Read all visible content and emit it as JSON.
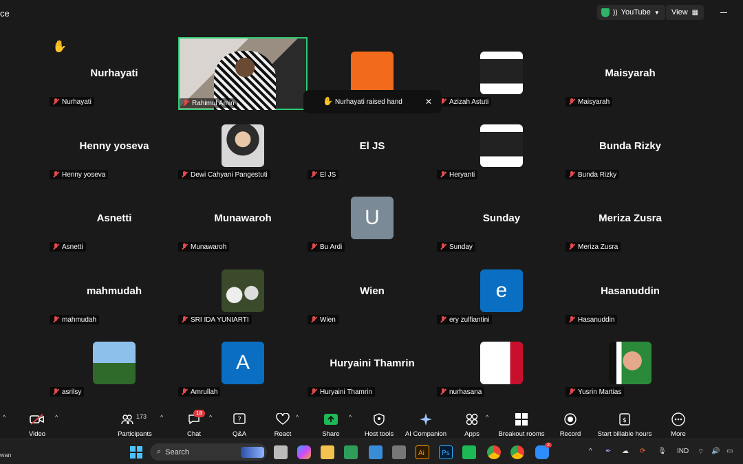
{
  "window": {
    "title_fragment": "ce"
  },
  "titlebar": {
    "stream_label": "YouTube",
    "view_label": "View"
  },
  "toast": {
    "text": "Nurhayati raised hand"
  },
  "hand_emoji": "✋",
  "participants": [
    {
      "display": "Nurhayati",
      "label": "Nurhayati",
      "type": "name"
    },
    {
      "display": "",
      "label": "Rahimul Amin",
      "type": "video"
    },
    {
      "display": "",
      "label": "",
      "type": "logo"
    },
    {
      "display": "",
      "label": "Azizah Astuti",
      "type": "poster"
    },
    {
      "display": "Maisyarah",
      "label": "Maisyarah",
      "type": "name"
    },
    {
      "display": "Henny yoseva",
      "label": "Henny yoseva",
      "type": "name"
    },
    {
      "display": "",
      "label": "Dewi Cahyani Pangestuti",
      "type": "photo-hijab"
    },
    {
      "display": "El JS",
      "label": "El JS",
      "type": "name"
    },
    {
      "display": "",
      "label": "Heryanti",
      "type": "poster"
    },
    {
      "display": "Bunda Rizky",
      "label": "Bunda Rizky",
      "type": "name"
    },
    {
      "display": "Asnetti",
      "label": "Asnetti",
      "type": "name"
    },
    {
      "display": "Munawaroh",
      "label": "Munawaroh",
      "type": "name"
    },
    {
      "display": "U",
      "label": "Bu Ardi",
      "type": "letter-gray"
    },
    {
      "display": "Sunday",
      "label": "Sunday",
      "type": "name"
    },
    {
      "display": "Meriza Zusra",
      "label": "Meriza Zusra",
      "type": "name"
    },
    {
      "display": "mahmudah",
      "label": "mahmudah",
      "type": "name"
    },
    {
      "display": "",
      "label": "SRI IDA YUNIARTI",
      "type": "photo-birds"
    },
    {
      "display": "Wien",
      "label": "Wien",
      "type": "name"
    },
    {
      "display": "e",
      "label": "ery zulfiantini",
      "type": "letter-blue"
    },
    {
      "display": "Hasanuddin",
      "label": "Hasanuddin",
      "type": "name"
    },
    {
      "display": "",
      "label": "asrilsy",
      "type": "photo-field"
    },
    {
      "display": "A",
      "label": "Amrullah",
      "type": "letter-blue"
    },
    {
      "display": "Huryaini Thamrin",
      "label": "Huryaini Thamrin",
      "type": "name"
    },
    {
      "display": "",
      "label": "nurhasana",
      "type": "photo-doa"
    },
    {
      "display": "",
      "label": "Yusrin Martias",
      "type": "photo-person"
    }
  ],
  "toolbar": {
    "video": "Video",
    "participants": "Participants",
    "participants_count": "173",
    "chat": "Chat",
    "chat_badge": "18",
    "qa": "Q&A",
    "react": "React",
    "share": "Share",
    "host_tools": "Host tools",
    "ai_companion": "AI Companion",
    "apps": "Apps",
    "breakout_rooms": "Breakout rooms",
    "record": "Record",
    "billable": "Start billable hours",
    "more": "More"
  },
  "taskbar": {
    "search_label": "Search",
    "left_fragment": "wan",
    "lang": "IND",
    "zoom_badge": "2"
  }
}
